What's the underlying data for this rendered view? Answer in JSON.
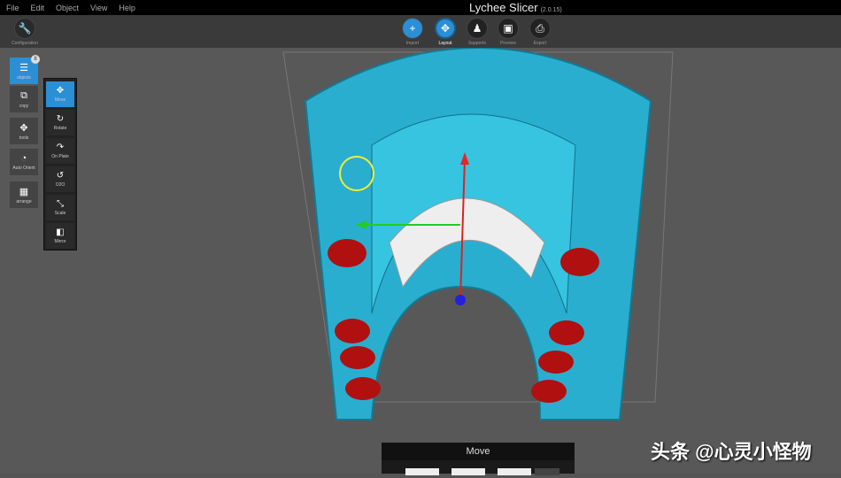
{
  "menubar": {
    "items": [
      "File",
      "Edit",
      "Object",
      "View",
      "Help"
    ]
  },
  "app": {
    "title": "Lychee Slicer",
    "version": "(2.0.15)"
  },
  "toolbar": {
    "configuration": "Configuration",
    "steps": [
      {
        "label": "Import",
        "icon": "plus-icon"
      },
      {
        "label": "Layout",
        "icon": "move-icon"
      },
      {
        "label": "Supports",
        "icon": "support-icon"
      },
      {
        "label": "Preview",
        "icon": "image-icon"
      },
      {
        "label": "Export",
        "icon": "printer-icon"
      }
    ]
  },
  "left_tools": [
    {
      "label": "objects",
      "badge": "8"
    },
    {
      "label": "copy"
    },
    {
      "label": "tools"
    },
    {
      "label": "Auto Orient"
    },
    {
      "label": "arrange"
    }
  ],
  "tools_submenu": [
    {
      "label": "Move"
    },
    {
      "label": "Rotate"
    },
    {
      "label": "On Plate"
    },
    {
      "label": "O2O"
    },
    {
      "label": "Scale"
    },
    {
      "label": "Mirror"
    }
  ],
  "move_panel": {
    "title": "Move"
  },
  "watermark": "头条 @心灵小怪物",
  "colors": {
    "accent": "#2b8fd6",
    "model": "#2bb7d6",
    "support": "#b01010"
  }
}
